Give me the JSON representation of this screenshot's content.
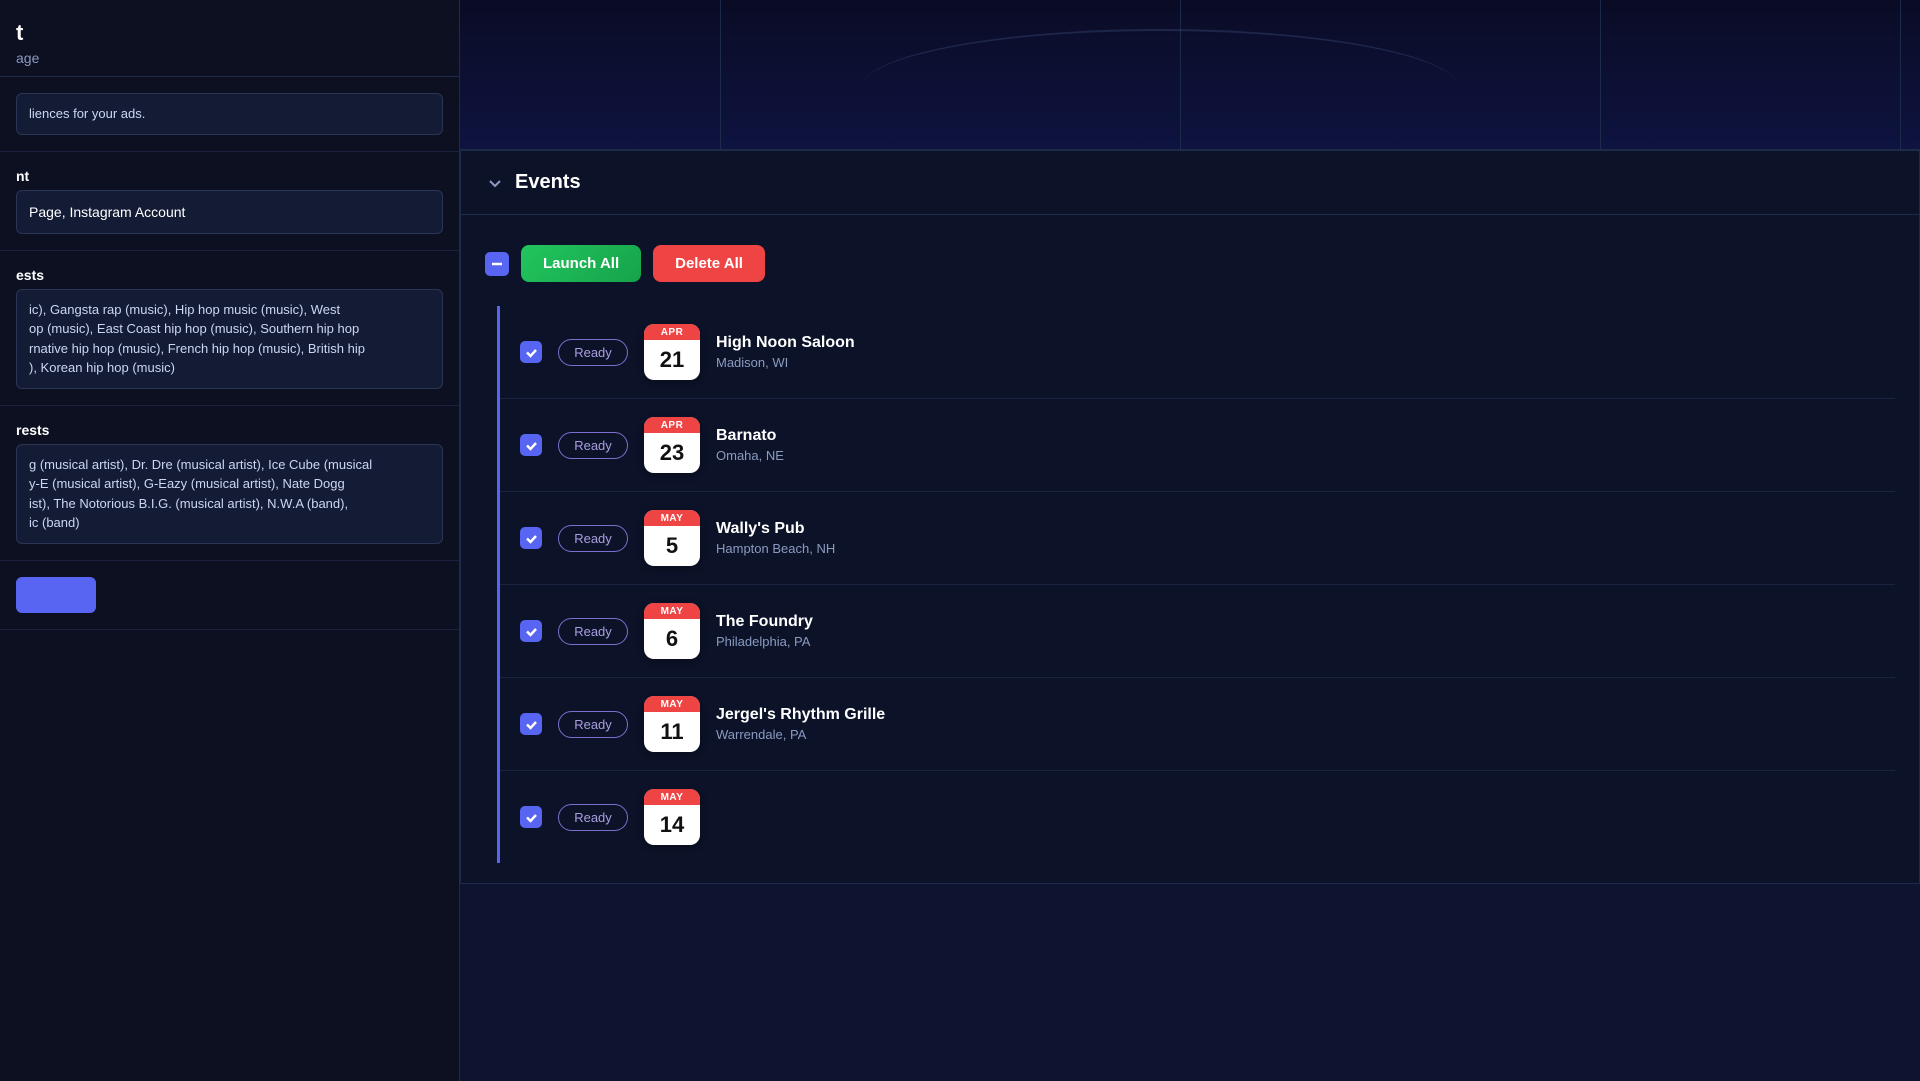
{
  "app": {
    "title": "t",
    "subtitle": "age"
  },
  "left_panel": {
    "page_label": "age",
    "input_placeholder": "",
    "label_audiences": "liences for your ads.",
    "label_account": "nt",
    "account_value": "Page, Instagram Account",
    "label_interests": "ests",
    "interests_text": "ic), Gangsta rap (music), Hip hop music (music), West\nop (music), East Coast hip hop (music), Southern hip hop\nrnative hip hop (music), French hip hop (music), British hip\n), Korean hip hop (music)",
    "label_artist_interests": "rests",
    "artist_text": "g (musical artist), Dr. Dre (musical artist), Ice Cube (musical\ny-E (musical artist), G-Eazy (musical artist), Nate Dogg\nist), The Notorious B.I.G. (musical artist), N.W.A (band),\nic (band)"
  },
  "events": {
    "section_title": "Events",
    "launch_all_label": "Launch All",
    "delete_all_label": "Delete All",
    "items": [
      {
        "id": 1,
        "checked": true,
        "status": "Ready",
        "month": "APR",
        "day": "21",
        "name": "High Noon Saloon",
        "location": "Madison, WI"
      },
      {
        "id": 2,
        "checked": true,
        "status": "Ready",
        "month": "APR",
        "day": "23",
        "name": "Barnato",
        "location": "Omaha, NE"
      },
      {
        "id": 3,
        "checked": true,
        "status": "Ready",
        "month": "MAY",
        "day": "5",
        "name": "Wally's Pub",
        "location": "Hampton Beach, NH"
      },
      {
        "id": 4,
        "checked": true,
        "status": "Ready",
        "month": "MAY",
        "day": "6",
        "name": "The Foundry",
        "location": "Philadelphia, PA"
      },
      {
        "id": 5,
        "checked": true,
        "status": "Ready",
        "month": "MAY",
        "day": "11",
        "name": "Jergel's Rhythm Grille",
        "location": "Warrendale, PA"
      },
      {
        "id": 6,
        "checked": true,
        "status": "Ready",
        "month": "MAY",
        "day": "14",
        "name": "",
        "location": ""
      }
    ]
  },
  "colors": {
    "accent_blue": "#5865f2",
    "accent_green": "#22c55e",
    "accent_red": "#ef4444",
    "ready_border": "#7c6fcd",
    "ready_text": "#a89ee0",
    "calendar_red": "#ef4444"
  }
}
